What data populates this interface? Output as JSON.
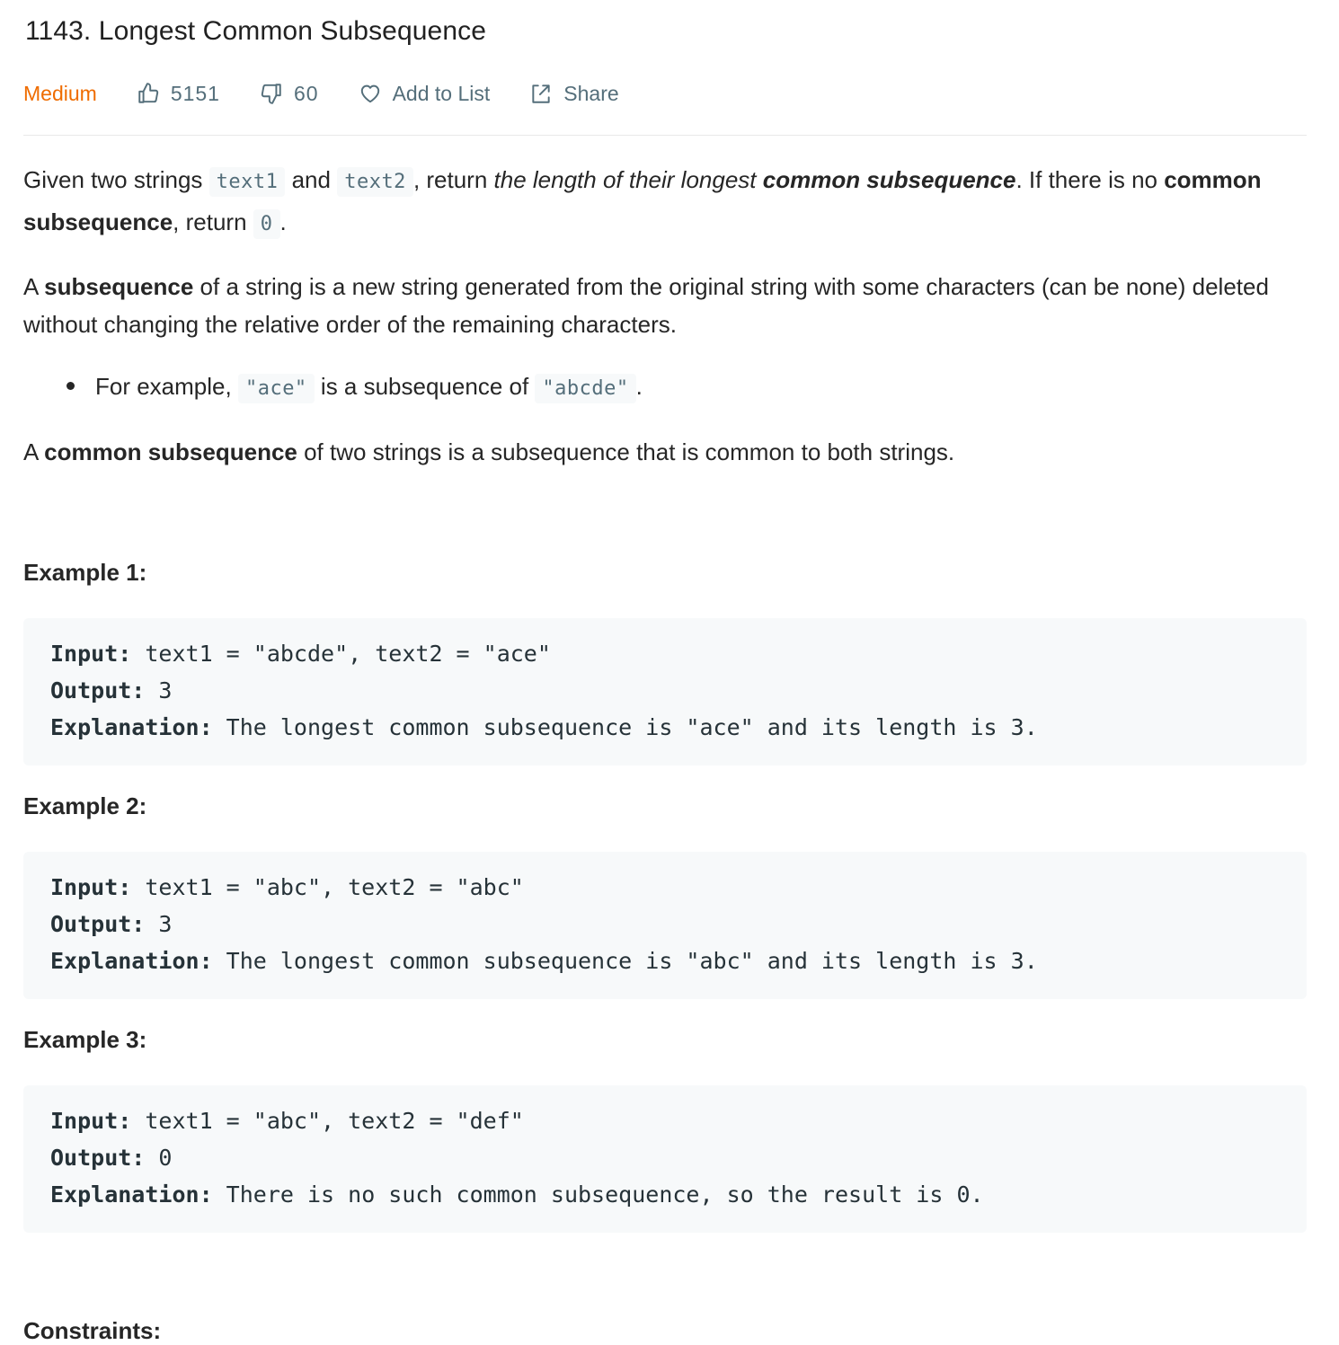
{
  "problem": {
    "title": "1143. Longest Common Subsequence",
    "difficulty": "Medium",
    "likes": "5151",
    "dislikes": "60",
    "add_to_list": "Add to List",
    "share": "Share"
  },
  "description": {
    "p1_a": "Given two strings ",
    "p1_code1": "text1",
    "p1_b": " and ",
    "p1_code2": "text2",
    "p1_c": ", return ",
    "p1_em": "the length of their longest ",
    "p1_em_strong": "common subsequence",
    "p1_d": ". If there is no ",
    "p1_strong": "common subsequence",
    "p1_e": ", return ",
    "p1_code3": "0",
    "p1_f": ".",
    "p2_a": "A ",
    "p2_strong": "subsequence",
    "p2_b": " of a string is a new string generated from the original string with some characters (can be none) deleted without changing the relative order of the remaining characters.",
    "bullet_a": "For example, ",
    "bullet_code1": "\"ace\"",
    "bullet_b": " is a subsequence of ",
    "bullet_code2": "\"abcde\"",
    "bullet_c": ".",
    "p3_a": "A ",
    "p3_strong": "common subsequence",
    "p3_b": " of two strings is a subsequence that is common to both strings."
  },
  "examples": [
    {
      "title": "Example 1:",
      "input_label": "Input:",
      "input": " text1 = \"abcde\", text2 = \"ace\"",
      "output_label": "Output:",
      "output": " 3",
      "explanation_label": "Explanation:",
      "explanation": " The longest common subsequence is \"ace\" and its length is 3."
    },
    {
      "title": "Example 2:",
      "input_label": "Input:",
      "input": " text1 = \"abc\", text2 = \"abc\"",
      "output_label": "Output:",
      "output": " 3",
      "explanation_label": "Explanation:",
      "explanation": " The longest common subsequence is \"abc\" and its length is 3."
    },
    {
      "title": "Example 3:",
      "input_label": "Input:",
      "input": " text1 = \"abc\", text2 = \"def\"",
      "output_label": "Output:",
      "output": " 0",
      "explanation_label": "Explanation:",
      "explanation": " There is no such common subsequence, so the result is 0."
    }
  ],
  "constraints_title": "Constraints:",
  "colors": {
    "difficulty_medium": "#ef6c00",
    "meta_text": "#546e7a",
    "code_bg": "#f7f9fa"
  },
  "icons": [
    "thumbs-up-icon",
    "thumbs-down-icon",
    "heart-icon",
    "share-icon"
  ]
}
